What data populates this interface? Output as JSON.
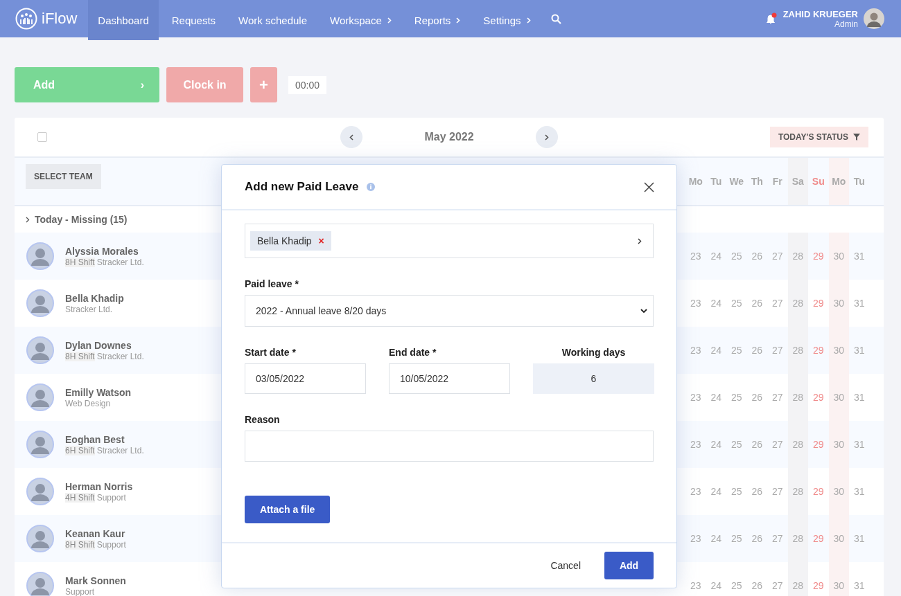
{
  "navbar": {
    "logo": "iFlow",
    "items": [
      {
        "label": "Dashboard",
        "selected": true,
        "submenu": false
      },
      {
        "label": "Requests",
        "selected": false,
        "submenu": false
      },
      {
        "label": "Work schedule",
        "selected": false,
        "submenu": false
      },
      {
        "label": "Workspace",
        "selected": false,
        "submenu": true
      },
      {
        "label": "Reports",
        "selected": false,
        "submenu": true
      },
      {
        "label": "Settings",
        "selected": false,
        "submenu": true
      }
    ],
    "notification_dot": true,
    "user": {
      "name": "ZAHID KRUEGER",
      "role": "Admin"
    }
  },
  "toolbar": {
    "add": "Add",
    "add_chevron": "›",
    "clock_in": "Clock in",
    "plus": "+",
    "timer": "00:00"
  },
  "calendar": {
    "select_all_checked": false,
    "month": "May 2022",
    "status_filter": "TODAY'S STATUS",
    "select_team": "SELECT TEAM",
    "days": [
      {
        "weekday": "Mo",
        "kind": "weekday"
      },
      {
        "weekday": "Tu",
        "kind": "weekday"
      },
      {
        "weekday": "We",
        "kind": "weekday"
      },
      {
        "weekday": "Th",
        "kind": "weekday"
      },
      {
        "weekday": "Fr",
        "kind": "weekday"
      },
      {
        "weekday": "Sa",
        "kind": "saturday"
      },
      {
        "weekday": "Su",
        "kind": "sunday"
      },
      {
        "weekday": "Mo",
        "kind": "holiday"
      },
      {
        "weekday": "Tu",
        "kind": "weekday"
      }
    ],
    "group": "Today - Missing (15)",
    "rows": [
      {
        "name": "Alyssia Morales",
        "shift": "8H Shift",
        "team": "Stracker Ltd.",
        "day_numbers": [
          "23",
          "24",
          "25",
          "26",
          "27",
          "28",
          "29",
          "30",
          "31"
        ]
      },
      {
        "name": "Bella Khadip",
        "team": "Stracker Ltd.",
        "day_numbers": [
          "23",
          "24",
          "25",
          "26",
          "27",
          "28",
          "29",
          "30",
          "31"
        ]
      },
      {
        "name": "Dylan Downes",
        "shift": "8H Shift",
        "team": "Stracker Ltd.",
        "day_numbers": [
          "23",
          "24",
          "25",
          "26",
          "27",
          "28",
          "29",
          "30",
          "31"
        ]
      },
      {
        "name": "Emilly Watson",
        "team": "Web Design",
        "day_numbers": [
          "23",
          "24",
          "25",
          "26",
          "27",
          "28",
          "29",
          "30",
          "31"
        ]
      },
      {
        "name": "Eoghan Best",
        "shift": "6H Shift",
        "team": "Stracker Ltd.",
        "day_numbers": [
          "23",
          "24",
          "25",
          "26",
          "27",
          "28",
          "29",
          "30",
          "31"
        ]
      },
      {
        "name": "Herman Norris",
        "shift": "4H Shift",
        "team": "Support",
        "day_numbers": [
          "23",
          "24",
          "25",
          "26",
          "27",
          "28",
          "29",
          "30",
          "31"
        ]
      },
      {
        "name": "Keanan Kaur",
        "shift": "8H Shift",
        "team": "Support",
        "day_numbers": [
          "23",
          "24",
          "25",
          "26",
          "27",
          "28",
          "29",
          "30",
          "31"
        ]
      },
      {
        "name": "Mark Sonnen",
        "team": "Support",
        "day_numbers": [
          "23",
          "24",
          "25",
          "26",
          "27",
          "28",
          "29",
          "30",
          "31"
        ]
      }
    ]
  },
  "modal": {
    "title": "Add new Paid Leave",
    "employee_chip": "Bella Khadip",
    "chip_remove": "×",
    "paid_leave_label": "Paid leave *",
    "paid_leave_value": "2022 - Annual leave 8/20 days",
    "start_label": "Start date *",
    "start_value": "03/05/2022",
    "end_label": "End date *",
    "end_value": "10/05/2022",
    "working_days_label": "Working days",
    "working_days_value": "6",
    "reason_label": "Reason",
    "attach": "Attach a file",
    "cancel": "Cancel",
    "submit": "Add"
  }
}
